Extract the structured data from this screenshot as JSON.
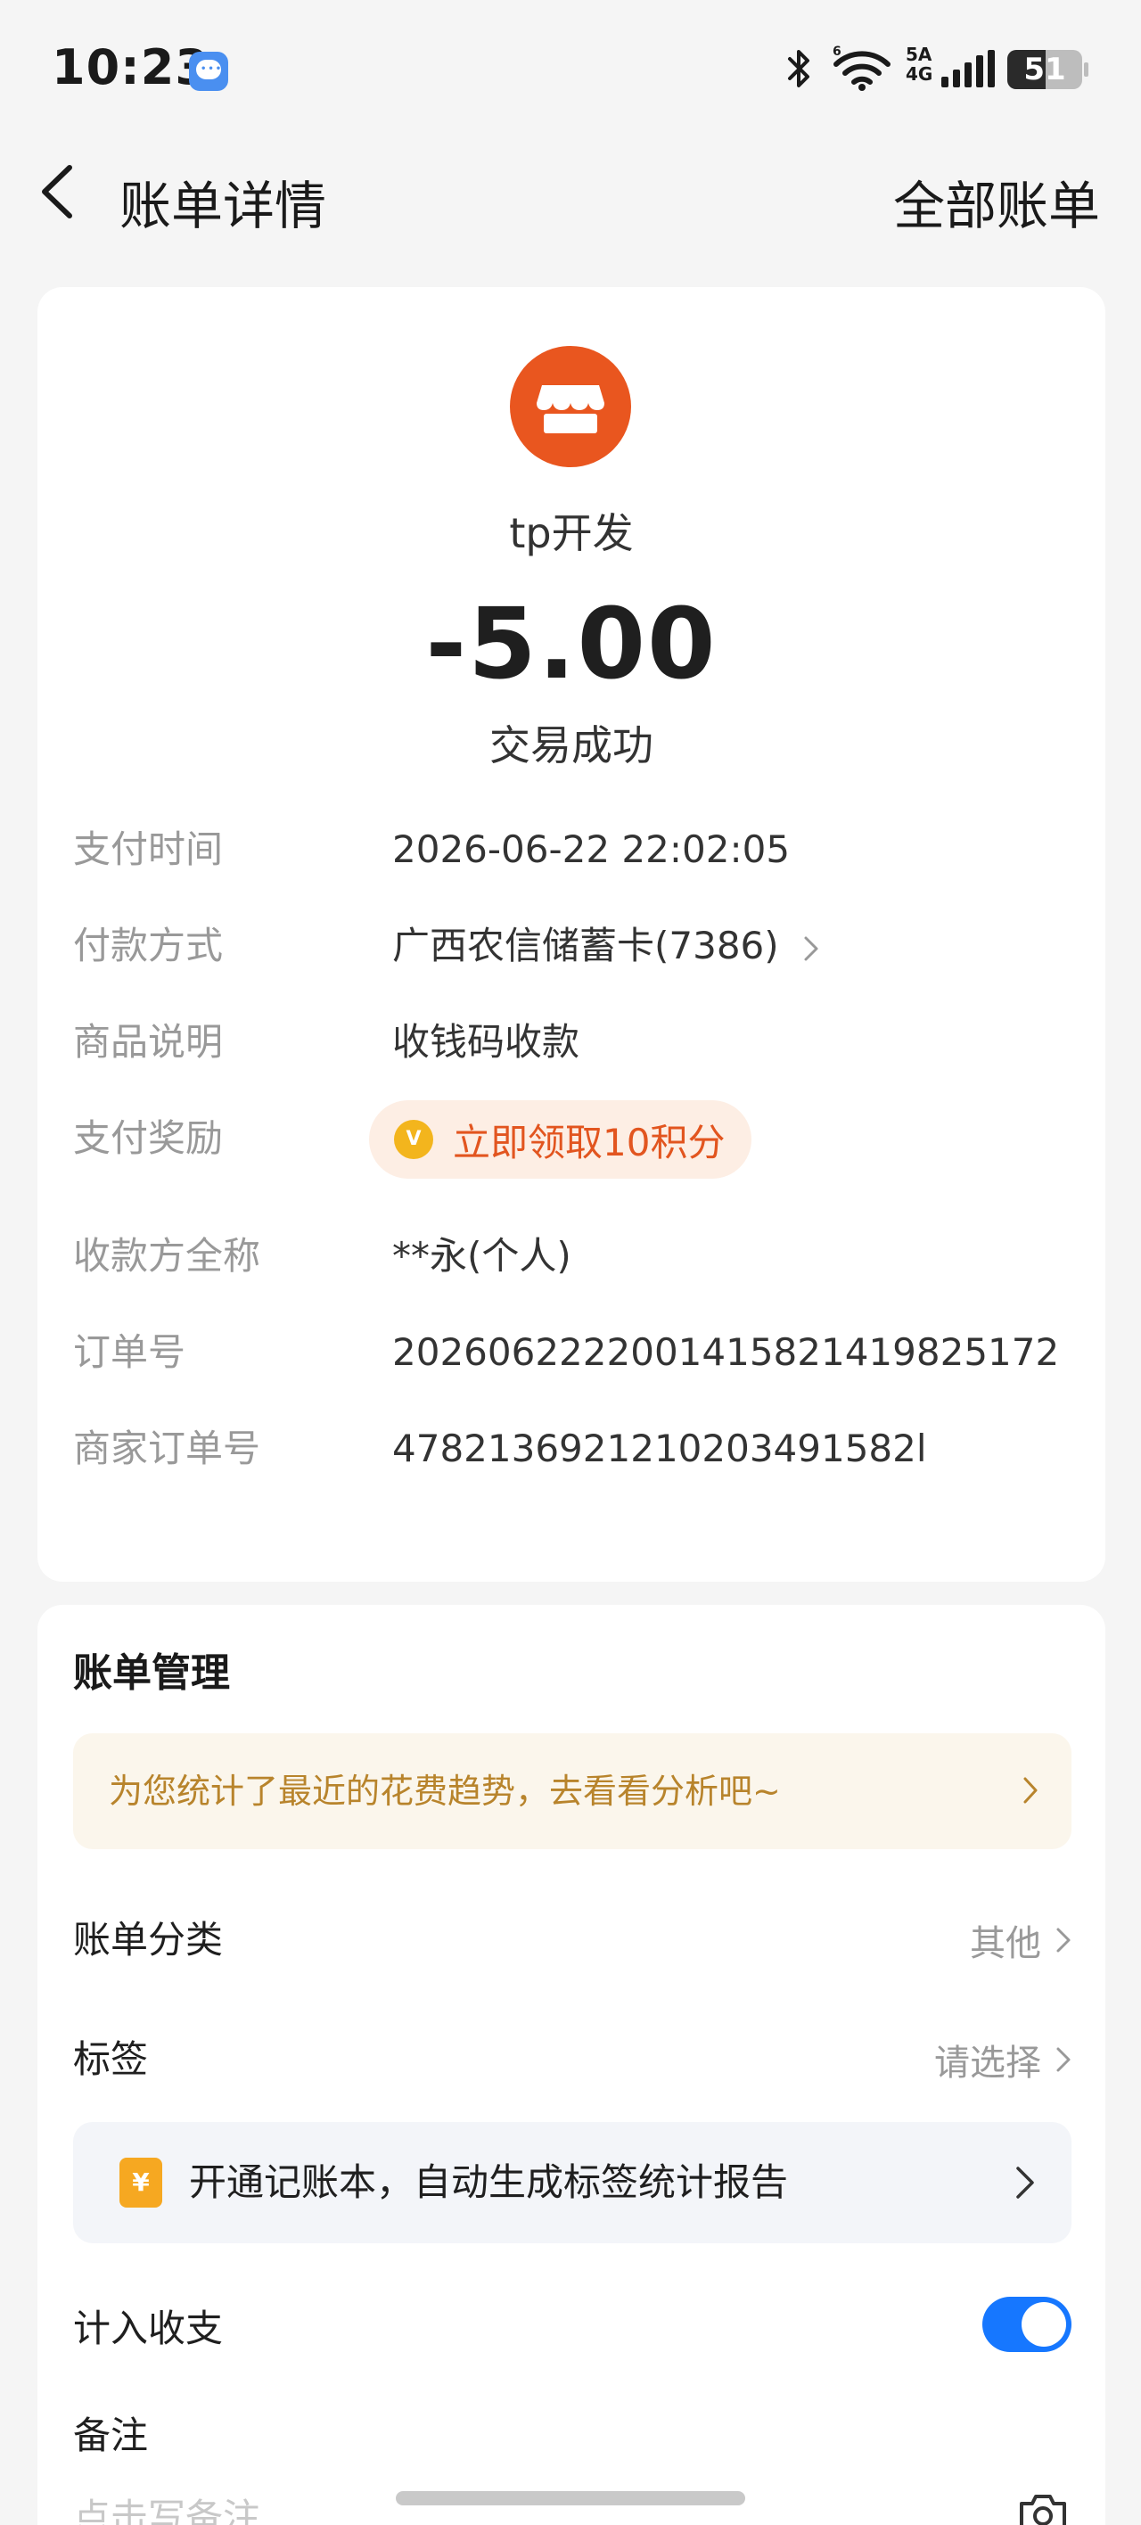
{
  "status_bar": {
    "time": "10:23",
    "network_label_top": "5A",
    "network_label_bottom": "4G",
    "battery": "51",
    "battery_level_percent": 51,
    "icons": [
      "message-icon",
      "bluetooth-icon",
      "wifi-icon",
      "signal-icon",
      "battery-icon"
    ]
  },
  "nav": {
    "title": "账单详情",
    "right_action": "全部账单"
  },
  "transaction": {
    "merchant_name": "tp开发",
    "amount": "-5.00",
    "status": "交易成功",
    "merchant_icon": "store-icon",
    "accent_color": "#e9561f"
  },
  "details": [
    {
      "label": "支付时间",
      "value": "2026-06-22 22:02:05"
    },
    {
      "label": "付款方式",
      "value": "广西农信储蓄卡(7386)"
    },
    {
      "label": "商品说明",
      "value": "收钱码收款"
    },
    {
      "label": "支付奖励",
      "value": "立即领取10积分"
    },
    {
      "label": "收款方全称",
      "value": "**永(个人)"
    },
    {
      "label": "订单号",
      "value": "2026062222001415821419825172"
    },
    {
      "label": "商家订单号",
      "value": "4782136921210203491582l"
    }
  ],
  "reward": {
    "coin_glyph": "V",
    "text_color": "#e2551f",
    "background": "#fdeee4"
  },
  "manage": {
    "title": "账单管理",
    "trend_banner": "为您统计了最近的花费趋势，去看看分析吧~",
    "category_label": "账单分类",
    "category_value": "其他",
    "tag_label": "标签",
    "tag_value": "请选择",
    "ledger_banner": "开通记账本，自动生成标签统计报告",
    "ledger_glyph": "¥",
    "include_label": "计入收支",
    "include_on": true,
    "toggle_color": "#1677ff",
    "note_label": "备注",
    "note_placeholder": "点击写备注"
  }
}
